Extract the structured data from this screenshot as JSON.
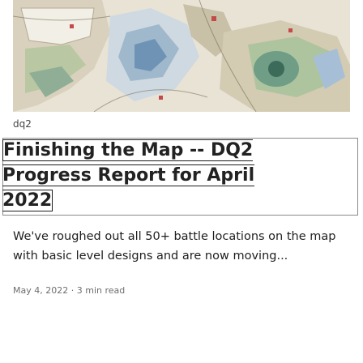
{
  "post": {
    "tag": "dq2",
    "title": "Finishing the Map -- DQ2 Progress Report for April 2022",
    "excerpt": "We've roughed out all 50+ battle locations on the map with basic level designs and are now moving...",
    "date": "May 4, 2022",
    "separator": "·",
    "read_time": "3 min read"
  },
  "colors": {
    "hero_base": "#e7e2d4",
    "hero_green": "#6fa08a",
    "hero_blue": "#7b9fc2",
    "hero_red": "#c34a4a"
  }
}
